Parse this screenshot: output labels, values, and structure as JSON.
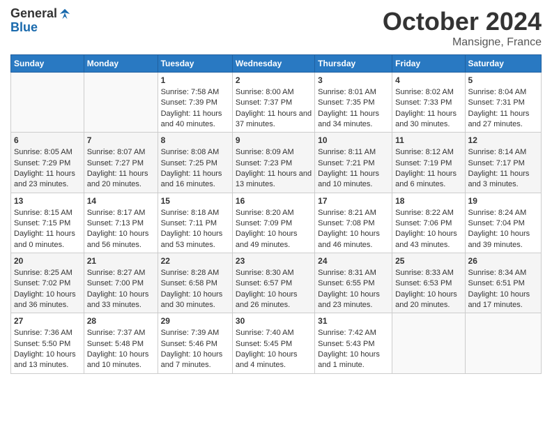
{
  "header": {
    "logo_general": "General",
    "logo_blue": "Blue",
    "month": "October 2024",
    "location": "Mansigne, France"
  },
  "days_of_week": [
    "Sunday",
    "Monday",
    "Tuesday",
    "Wednesday",
    "Thursday",
    "Friday",
    "Saturday"
  ],
  "weeks": [
    [
      {
        "day": "",
        "content": ""
      },
      {
        "day": "",
        "content": ""
      },
      {
        "day": "1",
        "content": "Sunrise: 7:58 AM\nSunset: 7:39 PM\nDaylight: 11 hours and 40 minutes."
      },
      {
        "day": "2",
        "content": "Sunrise: 8:00 AM\nSunset: 7:37 PM\nDaylight: 11 hours and 37 minutes."
      },
      {
        "day": "3",
        "content": "Sunrise: 8:01 AM\nSunset: 7:35 PM\nDaylight: 11 hours and 34 minutes."
      },
      {
        "day": "4",
        "content": "Sunrise: 8:02 AM\nSunset: 7:33 PM\nDaylight: 11 hours and 30 minutes."
      },
      {
        "day": "5",
        "content": "Sunrise: 8:04 AM\nSunset: 7:31 PM\nDaylight: 11 hours and 27 minutes."
      }
    ],
    [
      {
        "day": "6",
        "content": "Sunrise: 8:05 AM\nSunset: 7:29 PM\nDaylight: 11 hours and 23 minutes."
      },
      {
        "day": "7",
        "content": "Sunrise: 8:07 AM\nSunset: 7:27 PM\nDaylight: 11 hours and 20 minutes."
      },
      {
        "day": "8",
        "content": "Sunrise: 8:08 AM\nSunset: 7:25 PM\nDaylight: 11 hours and 16 minutes."
      },
      {
        "day": "9",
        "content": "Sunrise: 8:09 AM\nSunset: 7:23 PM\nDaylight: 11 hours and 13 minutes."
      },
      {
        "day": "10",
        "content": "Sunrise: 8:11 AM\nSunset: 7:21 PM\nDaylight: 11 hours and 10 minutes."
      },
      {
        "day": "11",
        "content": "Sunrise: 8:12 AM\nSunset: 7:19 PM\nDaylight: 11 hours and 6 minutes."
      },
      {
        "day": "12",
        "content": "Sunrise: 8:14 AM\nSunset: 7:17 PM\nDaylight: 11 hours and 3 minutes."
      }
    ],
    [
      {
        "day": "13",
        "content": "Sunrise: 8:15 AM\nSunset: 7:15 PM\nDaylight: 11 hours and 0 minutes."
      },
      {
        "day": "14",
        "content": "Sunrise: 8:17 AM\nSunset: 7:13 PM\nDaylight: 10 hours and 56 minutes."
      },
      {
        "day": "15",
        "content": "Sunrise: 8:18 AM\nSunset: 7:11 PM\nDaylight: 10 hours and 53 minutes."
      },
      {
        "day": "16",
        "content": "Sunrise: 8:20 AM\nSunset: 7:09 PM\nDaylight: 10 hours and 49 minutes."
      },
      {
        "day": "17",
        "content": "Sunrise: 8:21 AM\nSunset: 7:08 PM\nDaylight: 10 hours and 46 minutes."
      },
      {
        "day": "18",
        "content": "Sunrise: 8:22 AM\nSunset: 7:06 PM\nDaylight: 10 hours and 43 minutes."
      },
      {
        "day": "19",
        "content": "Sunrise: 8:24 AM\nSunset: 7:04 PM\nDaylight: 10 hours and 39 minutes."
      }
    ],
    [
      {
        "day": "20",
        "content": "Sunrise: 8:25 AM\nSunset: 7:02 PM\nDaylight: 10 hours and 36 minutes."
      },
      {
        "day": "21",
        "content": "Sunrise: 8:27 AM\nSunset: 7:00 PM\nDaylight: 10 hours and 33 minutes."
      },
      {
        "day": "22",
        "content": "Sunrise: 8:28 AM\nSunset: 6:58 PM\nDaylight: 10 hours and 30 minutes."
      },
      {
        "day": "23",
        "content": "Sunrise: 8:30 AM\nSunset: 6:57 PM\nDaylight: 10 hours and 26 minutes."
      },
      {
        "day": "24",
        "content": "Sunrise: 8:31 AM\nSunset: 6:55 PM\nDaylight: 10 hours and 23 minutes."
      },
      {
        "day": "25",
        "content": "Sunrise: 8:33 AM\nSunset: 6:53 PM\nDaylight: 10 hours and 20 minutes."
      },
      {
        "day": "26",
        "content": "Sunrise: 8:34 AM\nSunset: 6:51 PM\nDaylight: 10 hours and 17 minutes."
      }
    ],
    [
      {
        "day": "27",
        "content": "Sunrise: 7:36 AM\nSunset: 5:50 PM\nDaylight: 10 hours and 13 minutes."
      },
      {
        "day": "28",
        "content": "Sunrise: 7:37 AM\nSunset: 5:48 PM\nDaylight: 10 hours and 10 minutes."
      },
      {
        "day": "29",
        "content": "Sunrise: 7:39 AM\nSunset: 5:46 PM\nDaylight: 10 hours and 7 minutes."
      },
      {
        "day": "30",
        "content": "Sunrise: 7:40 AM\nSunset: 5:45 PM\nDaylight: 10 hours and 4 minutes."
      },
      {
        "day": "31",
        "content": "Sunrise: 7:42 AM\nSunset: 5:43 PM\nDaylight: 10 hours and 1 minute."
      },
      {
        "day": "",
        "content": ""
      },
      {
        "day": "",
        "content": ""
      }
    ]
  ]
}
